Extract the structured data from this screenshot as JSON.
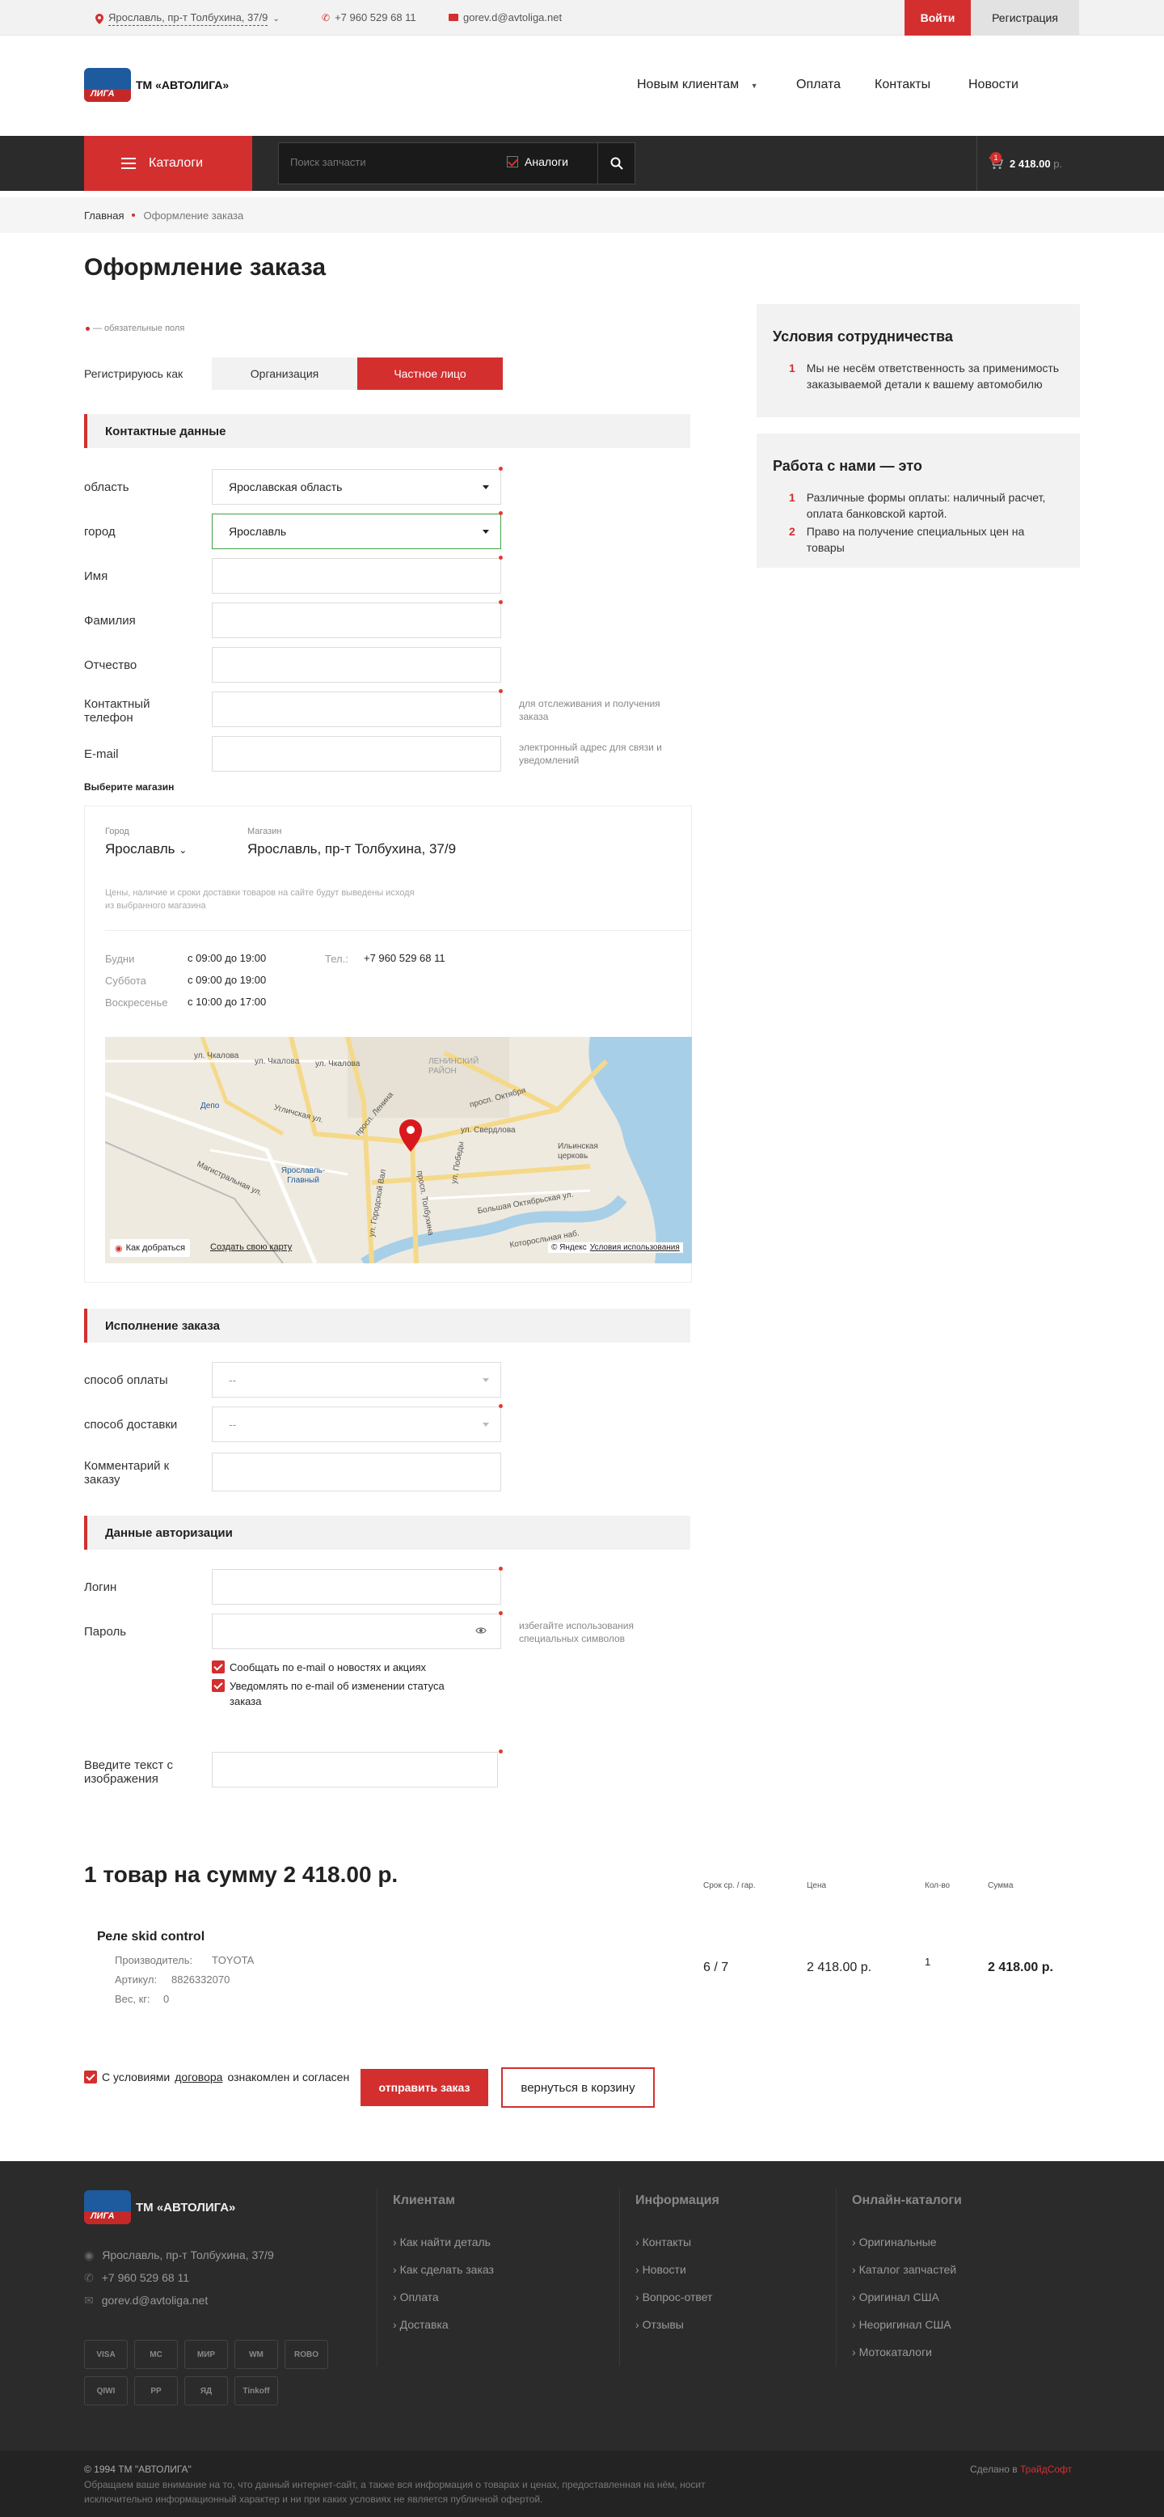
{
  "topbar": {
    "address": "Ярославль, пр-т Толбухина, 37/9",
    "phone": "+7 960 529 68 11",
    "email": "gorev.d@avtoliga.net",
    "login": "Войти",
    "register": "Регистрация"
  },
  "header": {
    "logo_mark": "ЛИГА",
    "logo_text": "ТМ «АВТОЛИГА»",
    "nav": [
      "Новым клиентам",
      "Оплата",
      "Контакты",
      "Новости"
    ]
  },
  "toolbar": {
    "catalogs": "Каталоги",
    "search_placeholder": "Поиск запчасти",
    "analogs": "Аналоги",
    "cart_count": "1",
    "cart_total": "2 418.00",
    "cart_currency": "р."
  },
  "breadcrumb": [
    "Главная",
    "Оформление заказа"
  ],
  "page_title": "Оформление заказа",
  "required_note": "— обязательные поля",
  "register_as": {
    "label": "Регистрируюсь как",
    "options": [
      "Организация",
      "Частное лицо"
    ],
    "selected": "Частное лицо"
  },
  "contact": {
    "section": "Контактные данные",
    "region_label": "область",
    "region_value": "Ярославская область",
    "city_label": "город",
    "city_value": "Ярославль",
    "first_name": "Имя",
    "last_name": "Фамилия",
    "patronymic": "Отчество",
    "phone_label": "Контактный телефон",
    "phone_hint": "для отслеживания и получения заказа",
    "email_label": "E-mail",
    "email_hint": "электронный адрес для связи и уведомлений"
  },
  "store": {
    "title": "Выберите магазин",
    "city_caption": "Город",
    "city": "Ярославль",
    "shop_caption": "Магазин",
    "shop": "Ярославль, пр-т Толбухина, 37/9",
    "note": "Цены, наличие и сроки доставки товаров на сайте будут выведены исходя из выбранного магазина",
    "hours": [
      {
        "day": "Будни",
        "time": "с 09:00 до 19:00"
      },
      {
        "day": "Суббота",
        "time": "с 09:00 до 19:00"
      },
      {
        "day": "Воскресенье",
        "time": "с 10:00 до 17:00"
      }
    ],
    "tel_label": "Тел.:",
    "tel": "+7 960 529 68 11"
  },
  "map": {
    "labels": [
      "ул. Чкалова",
      "ул. Чкалова",
      "ул. Чкалова",
      "ЛЕНИНСКИЙ РАЙОН",
      "просп. Октября",
      "Депо",
      "Угличская ул.",
      "просп. Ленина",
      "ул. Свердлова",
      "Ярославль-Главный",
      "Магистральная ул.",
      "ул. Городской Вал",
      "просп. Толбухина",
      "ул. Победы",
      "Ильинская церковь",
      "Большая Октябрьская ул.",
      "Которосльная наб."
    ],
    "route": "Как добраться",
    "create": "Создать свою карту",
    "credit": "© Яндекс",
    "terms": "Условия использования"
  },
  "fulfillment": {
    "section": "Исполнение заказа",
    "payment_label": "способ оплаты",
    "payment_value": "--",
    "delivery_label": "способ доставки",
    "delivery_value": "--",
    "comment_label": "Комментарий к заказу"
  },
  "auth": {
    "section": "Данные авторизации",
    "login_label": "Логин",
    "password_label": "Пароль",
    "password_hint": "избегайте использования специальных символов",
    "news_checkbox": "Сообщать по e-mail о новостях и акциях",
    "status_checkbox": "Уведомлять по e-mail об изменении статуса заказа",
    "captcha_label": "Введите текст с изображения"
  },
  "summary": {
    "title": "1 товар на сумму 2 418.00 р.",
    "columns": [
      "Срок ср. / гар.",
      "Цена",
      "Кол-во",
      "Сумма"
    ],
    "item": {
      "name": "Реле skid control",
      "maker_label": "Производитель:",
      "maker": "TOYOTA",
      "article_label": "Артикул:",
      "article": "8826332070",
      "weight_label": "Вес, кг:",
      "weight": "0",
      "term": "6 / 7",
      "price": "2 418.00 р.",
      "qty": "1",
      "sum": "2 418.00 р."
    }
  },
  "agreement": {
    "before": "С условиями",
    "link": "договора",
    "after": "ознакомлен и согласен",
    "submit": "отправить заказ",
    "back": "вернуться в корзину"
  },
  "sidebar": {
    "terms_title": "Условия сотрудничества",
    "terms": [
      "Мы не несём ответственность за применимость заказываемой детали к вашему автомобилю"
    ],
    "work_title": "Работа с нами — это",
    "work": [
      "Различные формы оплаты: наличный расчет, оплата банковской картой.",
      "Право на получение специальных цен на товары"
    ]
  },
  "footer": {
    "logo_text": "ТМ «АВТОЛИГА»",
    "address": "Ярославль, пр-т Толбухина, 37/9",
    "phone": "+7 960 529 68 11",
    "email": "gorev.d@avtoliga.net",
    "payments": [
      "VISA",
      "MC",
      "МИР",
      "WM",
      "ROBO",
      "QIWI",
      "PP",
      "ЯД",
      "Tinkoff"
    ],
    "clients_title": "Клиентам",
    "clients": [
      "Как найти деталь",
      "Как сделать заказ",
      "Оплата",
      "Доставка"
    ],
    "info_title": "Информация",
    "info": [
      "Контакты",
      "Новости",
      "Вопрос-ответ",
      "Отзывы"
    ],
    "catalogs_title": "Онлайн-каталоги",
    "catalogs": [
      "Оригинальные",
      "Каталог запчастей",
      "Оригинал США",
      "Неоригинал США",
      "Мотокаталоги"
    ],
    "copyright": "© 1994 ТМ \"АВТОЛИГА\"",
    "disclaimer": "Обращаем ваше внимание на то, что данный интернет-сайт, а также вся информация о товарах и ценах, предоставленная на нём, носит исключительно информационный характер и ни при каких условиях не является публичной офертой.",
    "made_by": "Сделано в",
    "made_by_link": "ТрайдСофт"
  },
  "colors": {
    "accent": "#d32f2f",
    "dark": "#2b2b2b",
    "focus": "#43a047"
  }
}
